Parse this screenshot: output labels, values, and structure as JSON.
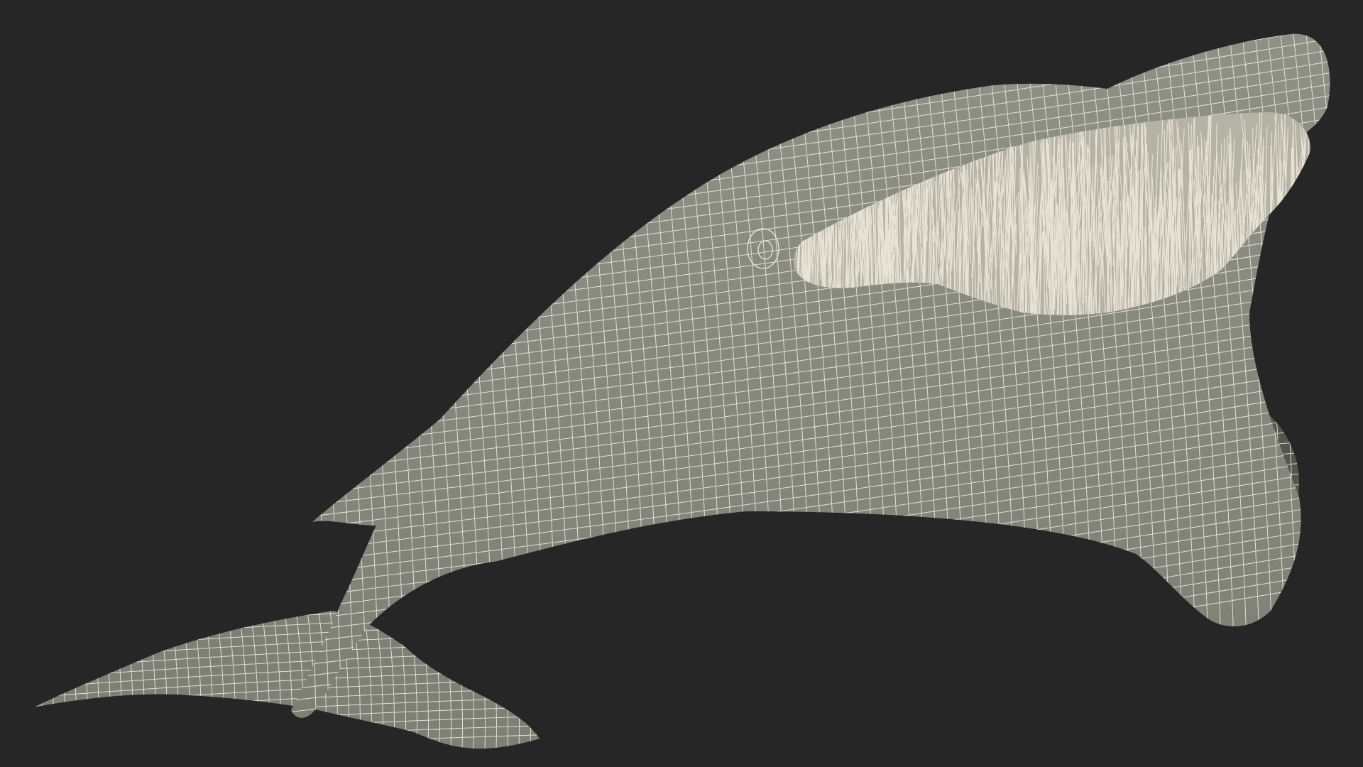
{
  "scene": {
    "subject": "whale-wireframe-model",
    "colors": {
      "background": "#262626",
      "surface": "#7e7f75",
      "surface_shadow": "#55564e",
      "surface_highlight": "#8f9086",
      "wire": "#f2f0e4",
      "baleen": "#ece9dc",
      "baleen_shadow": "#b5b3a6"
    },
    "icons": {
      "model": "whale-mesh-icon",
      "baleen": "baleen-fibers-icon"
    }
  }
}
